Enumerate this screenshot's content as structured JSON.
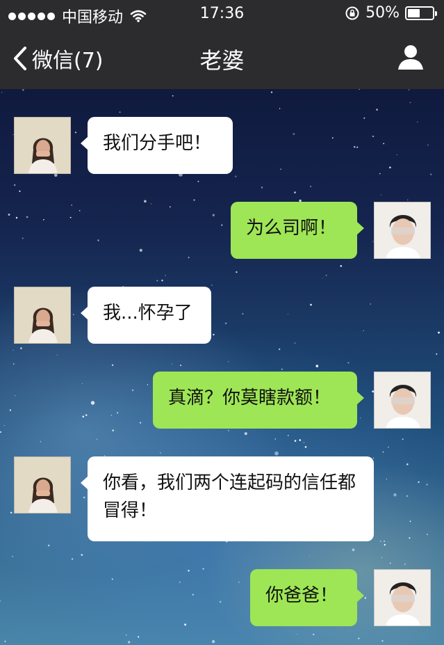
{
  "status_bar": {
    "carrier": "中国移动",
    "time": "17:36",
    "battery_text": "50%",
    "battery_level": 0.5,
    "icons": [
      "signal-dots-icon",
      "wifi-icon",
      "rotation-lock-icon",
      "battery-icon"
    ]
  },
  "nav": {
    "back_label": "微信(7)",
    "title": "老婆",
    "icons": [
      "chevron-left-icon",
      "profile-icon"
    ]
  },
  "messages": [
    {
      "from": "her",
      "text": "我们分手吧！"
    },
    {
      "from": "me",
      "text": "为么司啊！"
    },
    {
      "from": "her",
      "text": "我...怀孕了"
    },
    {
      "from": "me",
      "text": "真滴？你莫瞎款额！"
    },
    {
      "from": "her",
      "text": "你看，我们两个连起码的信任都冒得！"
    },
    {
      "from": "me",
      "text": "你爸爸！"
    }
  ],
  "colors": {
    "bar_background": "#2c2c2e",
    "incoming_bubble": "#ffffff",
    "outgoing_bubble": "#9ee655"
  }
}
